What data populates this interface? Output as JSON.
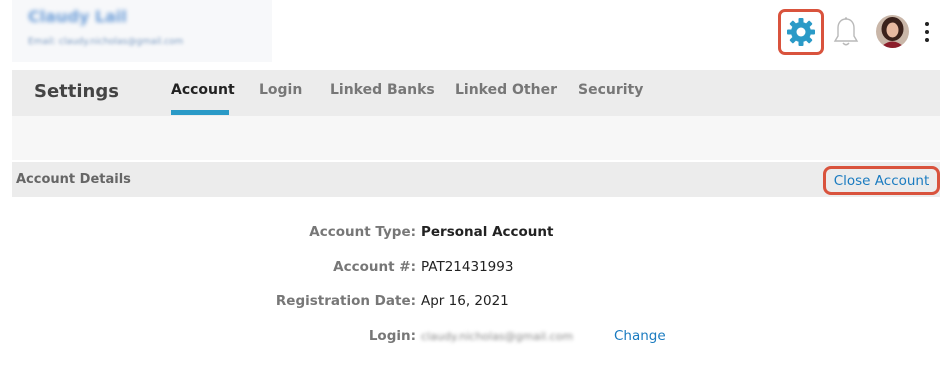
{
  "header": {
    "user_name": "Claudy Lail",
    "user_email_label": "Email:",
    "user_email": "claudy.nicholas@gmail.com"
  },
  "icons": {
    "settings": "gear-icon",
    "notifications": "bell-icon",
    "profile": "avatar",
    "more": "kebab-menu-icon"
  },
  "colors": {
    "accent": "#2a9ac7",
    "link": "#1a7bc0",
    "highlight_border": "#d9533d"
  },
  "settings": {
    "title": "Settings",
    "tabs": [
      {
        "label": "Account",
        "active": true
      },
      {
        "label": "Login",
        "active": false
      },
      {
        "label": "Linked Banks",
        "active": false
      },
      {
        "label": "Linked Other",
        "active": false
      },
      {
        "label": "Security",
        "active": false
      }
    ]
  },
  "account_details": {
    "section_title": "Account Details",
    "close_account_label": "Close Account",
    "rows": [
      {
        "label": "Account Type:",
        "value": "Personal Account"
      },
      {
        "label": "Account #:",
        "value": "PAT21431993"
      },
      {
        "label": "Registration Date:",
        "value": "Apr 16, 2021"
      },
      {
        "label": "Login:",
        "value": "claudy.nicholas@gmail.com",
        "action": "Change"
      }
    ]
  }
}
